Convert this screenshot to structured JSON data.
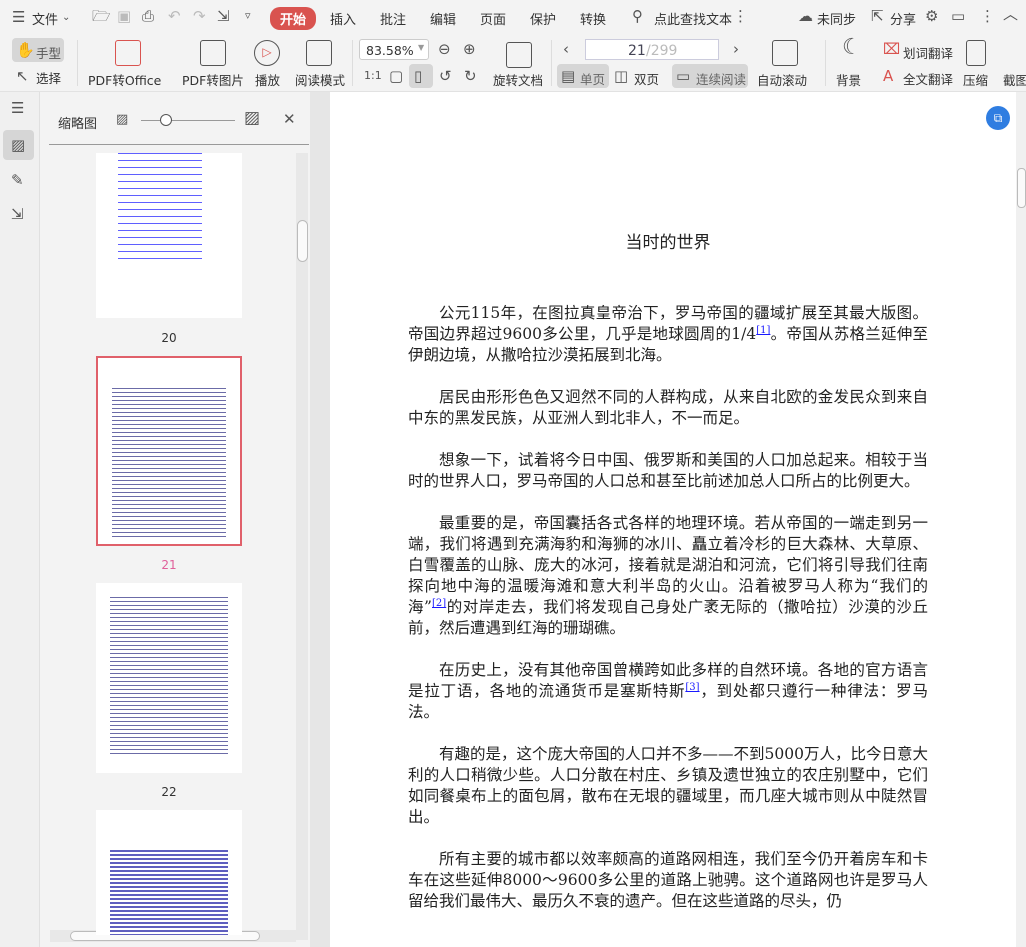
{
  "menu": {
    "file": "文件",
    "tabs": [
      "开始",
      "插入",
      "批注",
      "编辑",
      "页面",
      "保护",
      "转换"
    ],
    "search_placeholder": "点此查找文本",
    "sync": "未同步",
    "share": "分享"
  },
  "toolbar": {
    "hand": "手型",
    "select": "选择",
    "pdf_to_office": "PDF转Office",
    "pdf_to_image": "PDF转图片",
    "play": "播放",
    "read_mode": "阅读模式",
    "zoom": "83.58%",
    "rotate_doc": "旋转文档",
    "page_current": "21",
    "page_total": "/299",
    "single_page": "单页",
    "double_page": "双页",
    "continuous": "连续阅读",
    "auto_scroll": "自动滚动",
    "background": "背景",
    "word_translate": "划词翻译",
    "full_translate": "全文翻译",
    "compress": "压缩",
    "screenshot": "截图"
  },
  "panel": {
    "title": "缩略图",
    "pages": [
      "20",
      "21",
      "22"
    ],
    "selected_page": "21",
    "thumb_size_fraction": 0.3
  },
  "document": {
    "title": "当时的世界",
    "paragraphs": [
      {
        "a": "公元115年，在图拉真皇帝治下，罗马帝国的疆域扩展至其最大版图。帝国边界超过9600多公里，几乎是地球圆周的1/4",
        "sup": "[1]",
        "b": "。帝国从苏格兰延伸至伊朗边境，从撒哈拉沙漠拓展到北海。"
      },
      {
        "a": "居民由形形色色又迥然不同的人群构成，从来自北欧的金发民众到来自中东的黑发民族，从亚洲人到北非人，不一而足。"
      },
      {
        "a": "想象一下，试着将今日中国、俄罗斯和美国的人口加总起来。相较于当时的世界人口，罗马帝国的人口总和甚至比前述加总人口所占的比例更大。"
      },
      {
        "a": "最重要的是，帝国囊括各式各样的地理环境。若从帝国的一端走到另一端，我们将遇到充满海豹和海狮的冰川、矗立着冷杉的巨大森林、大草原、白雪覆盖的山脉、庞大的冰河，接着就是湖泊和河流，它们将引导我们往南探向地中海的温暖海滩和意大利半岛的火山。沿着被罗马人称为“我们的海”",
        "sup": "[2]",
        "b": "的对岸走去，我们将发现自己身处广袤无际的（撒哈拉）沙漠的沙丘前，然后遭遇到红海的珊瑚礁。"
      },
      {
        "a": "在历史上，没有其他帝国曾横跨如此多样的自然环境。各地的官方语言是拉丁语，各地的流通货币是塞斯特斯",
        "sup": "[3]",
        "b": "，到处都只遵行一种律法：罗马法。"
      },
      {
        "a": "有趣的是，这个庞大帝国的人口并不多——不到5000万人，比今日意大利的人口稍微少些。人口分散在村庄、乡镇及遗世独立的农庄别墅中，它们如同餐桌布上的面包屑，散布在无垠的疆域里，而几座大城市则从中陡然冒出。"
      },
      {
        "a": "所有主要的城市都以效率颇高的道路网相连，我们至今仍开着房车和卡车在这些延伸8000～9600多公里的道路上驰骋。这个道路网也许是罗马人留给我们最伟大、最历久不衰的遗产。但在这些道路的尽头，仍"
      }
    ]
  },
  "colors": {
    "accent": "#d9534f",
    "selected_thumb": "#e0606a",
    "link": "#1a1aff"
  }
}
